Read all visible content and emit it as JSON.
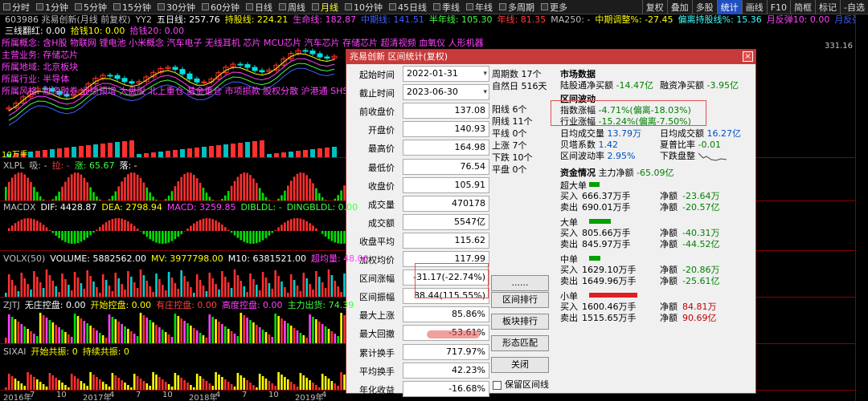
{
  "topbar": {
    "periods": [
      "分时",
      "1分钟",
      "5分钟",
      "15分钟",
      "30分钟",
      "60分钟",
      "日线",
      "周线",
      "月线",
      "10分钟",
      "45日线",
      "季线",
      "年线",
      "多周期",
      "更多"
    ],
    "active_period": "月线",
    "right_buttons": [
      "复权",
      "叠加",
      "多股",
      "统计",
      "画线",
      "F10",
      "简框",
      "标记",
      "-自选"
    ],
    "highlight_button": "统计"
  },
  "infoline": [
    {
      "text": "603986 兆易创新(月线 前复权)",
      "color": "#c0c0c0"
    },
    {
      "text": "YY2",
      "color": "#c0c0c0"
    },
    {
      "text": "五日线: 257.76",
      "color": "#ffffff"
    },
    {
      "text": "持股线: 224.21",
      "color": "#ffff00"
    },
    {
      "text": "生命线: 182.87",
      "color": "#ff40ff"
    },
    {
      "text": "中期线: 141.51",
      "color": "#4060ff"
    },
    {
      "text": "半年线: 105.30",
      "color": "#40ff40"
    },
    {
      "text": "年线: 81.35",
      "color": "#ff4040"
    },
    {
      "text": "MA250: -",
      "color": "#c0c0c0"
    },
    {
      "text": "中期调整%: -27.45",
      "color": "#ffff00"
    },
    {
      "text": "偏离持股线%: 15.36",
      "color": "#40ffff"
    },
    {
      "text": "月反弹10: 0.00",
      "color": "#ff40ff"
    },
    {
      "text": "月反弹20: 0.00",
      "color": "#4060ff"
    }
  ],
  "line2": [
    {
      "text": "三线翻红: 0.00",
      "color": "#ffffff"
    },
    {
      "text": "拾钱10: 0.00",
      "color": "#ffff00"
    },
    {
      "text": "拾钱20: 0.00",
      "color": "#ff40ff"
    }
  ],
  "info": {
    "concept": "所属概念: 含H股 物联网 锂电池 小米概念 汽车电子 无线耳机 芯片 MCU芯片 汽车芯片 存储芯片 超清视频 血氧仪 人形机器",
    "business": "主营业务: 存储芯片",
    "region": "所属地域: 北京板块",
    "industry": "所属行业: 半导体",
    "style": "所属风格: 融资融券 业绩预增 大盘股 北上重仓 基金重仓 市项损款 股权分散 沪港通 SHSM"
  },
  "main_label": "10万手",
  "axis_top": "331.16",
  "panels": [
    {
      "name": "xlpl",
      "title": [
        {
          "t": "XLPL",
          "c": "#c0c0c0"
        },
        {
          "t": "吸: -",
          "c": "#c0c0c0"
        },
        {
          "t": "拉: -",
          "c": "#ff4040"
        },
        {
          "t": "涨: 65.67",
          "c": "#40ff40"
        },
        {
          "t": "落: -",
          "c": "#ffffff"
        }
      ]
    },
    {
      "name": "macdx",
      "title": [
        {
          "t": "MACDX",
          "c": "#c0c0c0"
        },
        {
          "t": "DIF: 4428.87",
          "c": "#ffffff"
        },
        {
          "t": "DEA: 2798.94",
          "c": "#ffff00"
        },
        {
          "t": "MACD: 3259.85",
          "c": "#ff40ff"
        },
        {
          "t": "DIBLDL: -",
          "c": "#40ff40"
        },
        {
          "t": "DINGBLDL: 0.00",
          "c": "#40ff40"
        }
      ]
    },
    {
      "name": "volx",
      "title": [
        {
          "t": "VOLX(50)",
          "c": "#c0c0c0"
        },
        {
          "t": "VOLUME: 5882562.00",
          "c": "#ffffff"
        },
        {
          "t": "MV: 3977798.00",
          "c": "#ffff00"
        },
        {
          "t": "M10: 6381521.00",
          "c": "#ffffff"
        },
        {
          "t": "超均量: 48.00",
          "c": "#ff40ff"
        }
      ]
    },
    {
      "name": "zjtj",
      "title": [
        {
          "t": "ZJTJ",
          "c": "#c0c0c0"
        },
        {
          "t": "无庄控盘: 0.00",
          "c": "#ffffff"
        },
        {
          "t": "开始控盘: 0.00",
          "c": "#ffff00"
        },
        {
          "t": "有庄控盘: 0.00",
          "c": "#ff4040"
        },
        {
          "t": "高度控盘: 0.00",
          "c": "#ff40ff"
        },
        {
          "t": "主力出货: 74.39",
          "c": "#40ff40"
        }
      ]
    },
    {
      "name": "sixai",
      "title": [
        {
          "t": "SIXAI",
          "c": "#c0c0c0"
        },
        {
          "t": "开始共振: 0",
          "c": "#ffff00"
        },
        {
          "t": "持续共振: 0",
          "c": "#ffff00"
        }
      ]
    }
  ],
  "xaxis": [
    "2016年",
    "7",
    "10",
    "2017年",
    "4",
    "7",
    "10",
    "2018年",
    "4",
    "7",
    "10",
    "2019年",
    "4"
  ],
  "dialog": {
    "title": "兆易创新 区间统计(复权)",
    "close": "×",
    "rows": [
      {
        "label": "起始时间",
        "value": "2022-01-31",
        "date": true
      },
      {
        "label": "截止时间",
        "value": "2023-06-30",
        "date": true
      },
      {
        "label": "前收盘价",
        "value": "137.08"
      },
      {
        "label": "开盘价",
        "value": "140.93"
      },
      {
        "label": "最高价",
        "value": "164.98"
      },
      {
        "label": "最低价",
        "value": "76.54"
      },
      {
        "label": "收盘价",
        "value": "105.91"
      },
      {
        "label": "成交量",
        "value": "470178"
      },
      {
        "label": "成交额",
        "value": "5547亿"
      },
      {
        "label": "收盘平均",
        "value": "115.62"
      },
      {
        "label": "加权均价",
        "value": "117.99"
      },
      {
        "label": "区间涨幅",
        "value": "-31.17(-22.74%)"
      },
      {
        "label": "区间振幅",
        "value": "88.44(115.55%)"
      },
      {
        "label": "最大上涨",
        "value": "85.86%"
      },
      {
        "label": "最大回撤",
        "value": "-53.61%"
      },
      {
        "label": "累计换手",
        "value": "717.97%"
      },
      {
        "label": "平均换手",
        "value": "42.23%"
      },
      {
        "label": "年化收益",
        "value": "-16.68%"
      }
    ],
    "period": [
      "周期数 17个",
      "自然日 516天"
    ],
    "counts": [
      "阳线 6个",
      "阴线 11个",
      "平线 0个",
      "上涨 7个",
      "下跌 10个",
      "平盘 0个"
    ],
    "buttons": {
      "dots": "......",
      "rank": "区间排行",
      "sector_rank": "板块排行",
      "pattern": "形态匹配",
      "close": "关闭"
    },
    "keep_checkbox": "保留区间线",
    "market": {
      "head": "市场数据",
      "lgt_label": "陆股通净买额",
      "lgt_value": "-14.47亿",
      "margin_label": "融资净买额",
      "margin_value": "-3.95亿"
    },
    "wave": {
      "head": "区间波动",
      "index_label": "指数涨幅",
      "index_value": "-4.71%(偏离-18.03%)",
      "industry_label": "行业涨幅",
      "industry_value": "-15.24%(偏离-7.50%)",
      "daily_vol_label": "日均成交量",
      "daily_vol_value": "13.79万",
      "daily_amt_label": "日均成交额",
      "daily_amt_value": "16.27亿",
      "beta_label": "贝塔系数",
      "beta_value": "1.42",
      "sharpe_label": "夏普比率",
      "sharpe_value": "-0.01",
      "volatility_label": "区间波动率",
      "volatility_value": "2.95%",
      "disk_label": "下跌盘整"
    },
    "funds": {
      "head": "资金情况",
      "main_label": "主力净额",
      "main_value": "-65.09亿",
      "groups": [
        {
          "name": "超大单",
          "buy_label": "买入",
          "buy": "666.37万手",
          "sell_label": "卖出",
          "sell": "690.01万手",
          "net_label": "净额",
          "net1": "-23.64万",
          "net2": "-20.57亿",
          "bar_color": "#00a000",
          "bar_frac": 0.18
        },
        {
          "name": "大单",
          "buy_label": "买入",
          "buy": "805.66万手",
          "sell_label": "卖出",
          "sell": "845.97万手",
          "net_label": "净额",
          "net1": "-40.31万",
          "net2": "-44.52亿",
          "bar_color": "#00a000",
          "bar_frac": 0.38
        },
        {
          "name": "中单",
          "buy_label": "买入",
          "buy": "1629.10万手",
          "sell_label": "卖出",
          "sell": "1649.96万手",
          "net_label": "净额",
          "net1": "-20.86万",
          "net2": "-25.61亿",
          "bar_color": "#00a000",
          "bar_frac": 0.2
        },
        {
          "name": "小单",
          "buy_label": "买入",
          "buy": "1600.46万手",
          "sell_label": "卖出",
          "sell": "1515.65万手",
          "net_label": "净额",
          "net1": "84.81万",
          "net2": "90.69亿",
          "bar_color": "#e02020",
          "bar_frac": 0.85
        }
      ]
    }
  }
}
